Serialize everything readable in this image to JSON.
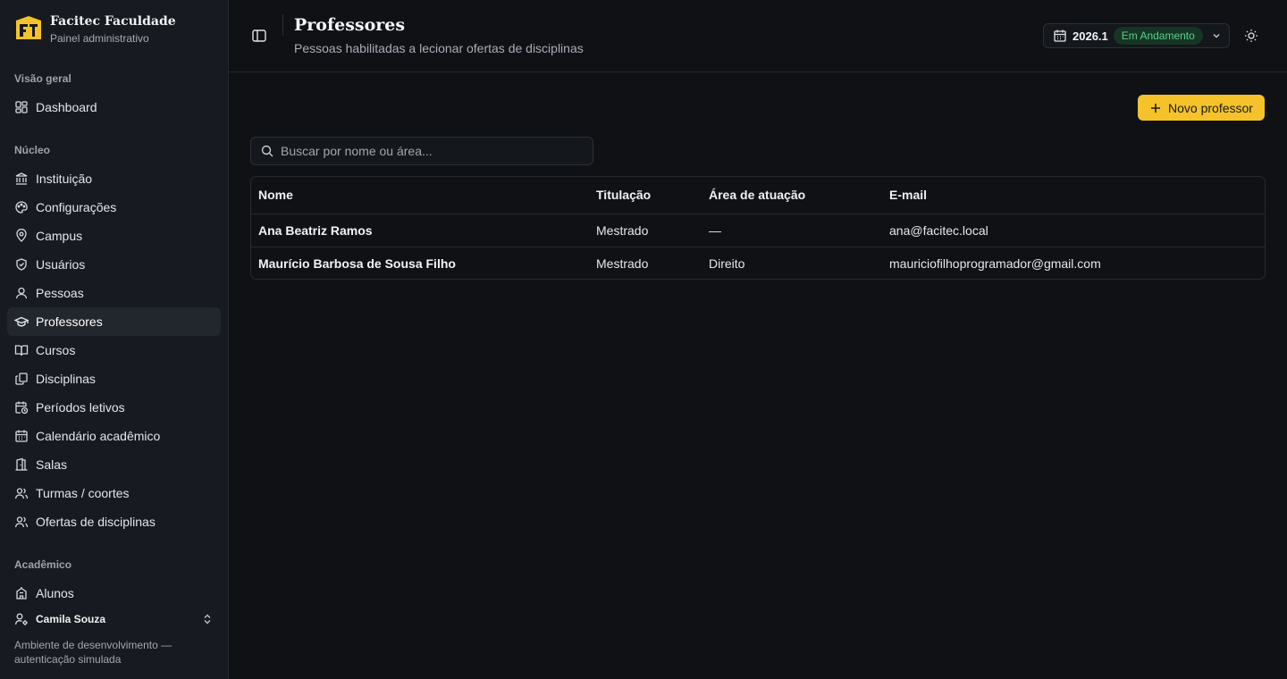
{
  "brand": {
    "name": "Facitec Faculdade",
    "subtitle": "Painel administrativo"
  },
  "sidebar": {
    "sections": [
      {
        "label": "Visão geral"
      },
      {
        "label": "Núcleo"
      },
      {
        "label": "Acadêmico"
      }
    ],
    "items": [
      {
        "label": "Dashboard",
        "icon": "grid-icon"
      },
      {
        "label": "Instituição",
        "icon": "landmark-icon"
      },
      {
        "label": "Configurações",
        "icon": "palette-icon"
      },
      {
        "label": "Campus",
        "icon": "map-pin-icon"
      },
      {
        "label": "Usuários",
        "icon": "shield-icon"
      },
      {
        "label": "Pessoas",
        "icon": "user-icon"
      },
      {
        "label": "Professores",
        "icon": "graduation-cap-icon",
        "active": true
      },
      {
        "label": "Cursos",
        "icon": "book-open-icon"
      },
      {
        "label": "Disciplinas",
        "icon": "files-icon"
      },
      {
        "label": "Períodos letivos",
        "icon": "calendar-clock-icon"
      },
      {
        "label": "Calendário acadêmico",
        "icon": "calendar-icon"
      },
      {
        "label": "Salas",
        "icon": "door-icon"
      },
      {
        "label": "Turmas / coortes",
        "icon": "users-icon"
      },
      {
        "label": "Ofertas de disciplinas",
        "icon": "users-icon"
      },
      {
        "label": "Alunos",
        "icon": "school-icon"
      }
    ],
    "user": {
      "name": "Camila Souza",
      "icon": "user-cog-icon"
    },
    "env_note": "Ambiente de desenvolvimento — autenticação simulada"
  },
  "header": {
    "title": "Professores",
    "subtitle": "Pessoas habilitadas a lecionar ofertas de disciplinas",
    "period": {
      "label": "2026.1",
      "status": "Em Andamento"
    },
    "theme_icon": "sun-icon"
  },
  "toolbar": {
    "new_label": "Novo professor"
  },
  "search": {
    "placeholder": "Buscar por nome ou área...",
    "value": ""
  },
  "table": {
    "columns": [
      "Nome",
      "Titulação",
      "Área de atuação",
      "E-mail"
    ],
    "rows": [
      [
        "Ana Beatriz Ramos",
        "Mestrado",
        "—",
        "ana@facitec.local"
      ],
      [
        "Maurício Barbosa de Sousa Filho",
        "Mestrado",
        "Direito",
        "mauriciofilhoprogramador@gmail.com"
      ]
    ]
  },
  "colors": {
    "accent": "#f5c22a",
    "status_badge_bg": "#163524",
    "status_badge_text": "#58d08a"
  }
}
